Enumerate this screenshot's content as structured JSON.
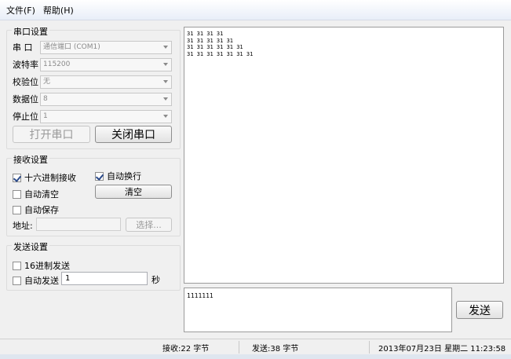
{
  "menu": {
    "file": "文件(F)",
    "help": "帮助(H)"
  },
  "serial": {
    "title": "串口设置",
    "port_label": "串 口",
    "port_value": "通信端口 (COM1)",
    "baud_label": "波特率",
    "baud_value": "115200",
    "parity_label": "校验位",
    "parity_value": "无",
    "databits_label": "数据位",
    "databits_value": "8",
    "stopbits_label": "停止位",
    "stopbits_value": "1",
    "open_button": "打开串口",
    "close_button": "关闭串口"
  },
  "receive": {
    "title": "接收设置",
    "hex_receive": "十六进制接收",
    "auto_wrap": "自动换行",
    "auto_clear": "自动清空",
    "clear_button": "清空",
    "auto_save": "自动保存",
    "address_label": "地址:",
    "address_value": "",
    "choose_button": "选择..."
  },
  "send": {
    "title": "发送设置",
    "hex_send": "16进制发送",
    "auto_send": "自动发送",
    "interval_value": "1",
    "seconds_label": "秒",
    "input_value": "1111111",
    "send_button": "发送"
  },
  "received_text": "31 31 31 31\n31 31 31 31 31\n31 31 31 31 31 31\n31 31 31 31 31 31 31",
  "status": {
    "received": "接收:22 字节",
    "sent": "发送:38 字节",
    "datetime": "2013年07月23日 星期二 11:23:58"
  },
  "checks": {
    "hex_receive": true,
    "auto_wrap": true,
    "auto_clear": false,
    "auto_save": false,
    "hex_send": false,
    "auto_send": false
  }
}
